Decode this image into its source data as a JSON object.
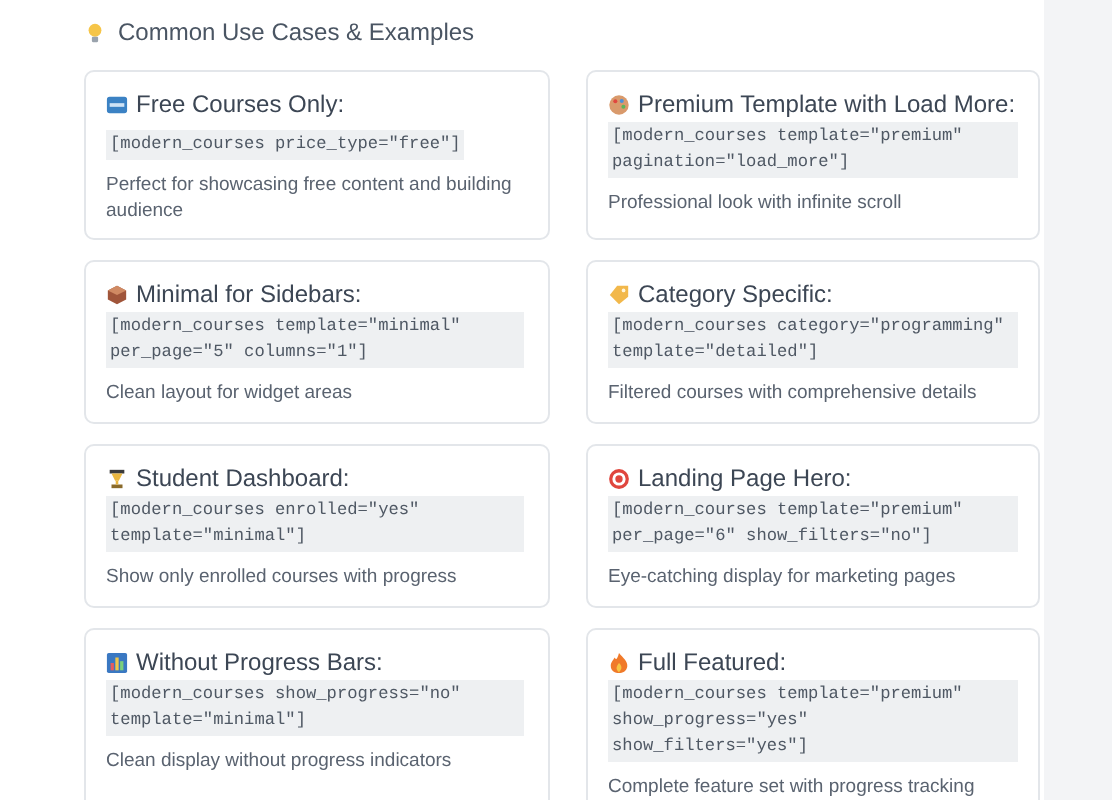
{
  "section": {
    "title": "Common Use Cases & Examples"
  },
  "cards": [
    {
      "title": "Free Courses Only:",
      "code": "[modern_courses price_type=\"free\"]",
      "description": "Perfect for showcasing free content and building audience"
    },
    {
      "title": "Premium Template with Load More:",
      "code": "[modern_courses template=\"premium\" pagination=\"load_more\"]",
      "description": "Professional look with infinite scroll"
    },
    {
      "title": "Minimal for Sidebars:",
      "code": "[modern_courses template=\"minimal\" per_page=\"5\" columns=\"1\"]",
      "description": "Clean layout for widget areas"
    },
    {
      "title": "Category Specific:",
      "code": "[modern_courses category=\"programming\" template=\"detailed\"]",
      "description": "Filtered courses with comprehensive details"
    },
    {
      "title": "Student Dashboard:",
      "code": "[modern_courses enrolled=\"yes\" template=\"minimal\"]",
      "description": "Show only enrolled courses with progress"
    },
    {
      "title": "Landing Page Hero:",
      "code": "[modern_courses template=\"premium\" per_page=\"6\" show_filters=\"no\"]",
      "description": "Eye-catching display for marketing pages"
    },
    {
      "title": "Without Progress Bars:",
      "code": "[modern_courses show_progress=\"no\" template=\"minimal\"]",
      "description": "Clean display without progress indicators"
    },
    {
      "title": "Full Featured:",
      "code": "[modern_courses template=\"premium\" show_progress=\"yes\" show_filters=\"yes\"]",
      "description": "Complete feature set with progress tracking"
    }
  ]
}
